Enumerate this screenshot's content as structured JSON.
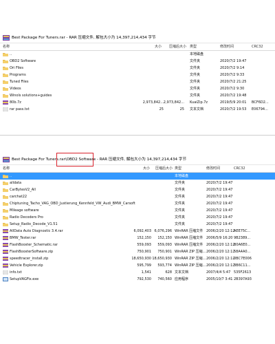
{
  "colors": {
    "selection": "#3399ff",
    "highlight_box": "#d9212b",
    "folder": "#e8b84a"
  },
  "top": {
    "title": "Best Package For Tuners.rar - RAR 压缩文件, 解包大小为 14,397,214,434 字节",
    "headers": {
      "name": "名称",
      "size": "大小",
      "packed": "压缩后大小",
      "type": "类型",
      "modified": "修改时间",
      "crc": "CRC32"
    },
    "rows": [
      {
        "icon": "folder-icon",
        "name": "..",
        "size": "",
        "packed": "",
        "type": "本地磁盘",
        "modified": "",
        "crc": ""
      },
      {
        "icon": "folder-icon",
        "name": "OBD2 Software",
        "size": "",
        "packed": "",
        "type": "文件夹",
        "modified": "2020/7/2 19:47",
        "crc": ""
      },
      {
        "icon": "folder-icon",
        "name": "Ori Files",
        "size": "",
        "packed": "",
        "type": "文件夹",
        "modified": "2020/7/2 9:14",
        "crc": ""
      },
      {
        "icon": "folder-icon",
        "name": "Programs",
        "size": "",
        "packed": "",
        "type": "文件夹",
        "modified": "2020/7/2 9:33",
        "crc": ""
      },
      {
        "icon": "folder-icon",
        "name": "Tuned Files",
        "size": "",
        "packed": "",
        "type": "文件夹",
        "modified": "2020/7/2 21:25",
        "crc": ""
      },
      {
        "icon": "folder-icon",
        "name": "Videos",
        "size": "",
        "packed": "",
        "type": "文件夹",
        "modified": "2020/7/2 9:30",
        "crc": ""
      },
      {
        "icon": "folder-icon",
        "name": "Winols solutions+guides",
        "size": "",
        "packed": "",
        "type": "文件夹",
        "modified": "2020/7/2 19:48",
        "crc": ""
      },
      {
        "icon": "archive-icon",
        "name": "80b.7z",
        "size": "2,973,842...",
        "packed": "2,973,842...",
        "type": "KuaiZip.7z",
        "modified": "2019/5/9 20:01",
        "crc": "BCF6D2..."
      },
      {
        "icon": "text-file-icon",
        "name": "rar pass.txt",
        "size": "25",
        "packed": "25",
        "type": "文本文档",
        "modified": "2020/7/2 19:53",
        "crc": "E06794..."
      }
    ]
  },
  "bottom": {
    "title_prefix": "Best Package For Tuners.rar\\",
    "title_highlight": "OBD2 Software",
    "title_suffix": " - RAR 压缩文件, 解包大小为 14,397,214,434 字节",
    "headers": {
      "name": "名称",
      "size": "大小",
      "packed": "压缩后大小",
      "type": "类型",
      "modified": "修改时间",
      "crc": "CRC32"
    },
    "rows": [
      {
        "icon": "folder-icon",
        "name": "..",
        "size": "",
        "packed": "",
        "type": "本地磁盘",
        "modified": "",
        "crc": "",
        "selected": true
      },
      {
        "icon": "folder-icon",
        "name": "alldata",
        "size": "",
        "packed": "",
        "type": "文件夹",
        "modified": "2020/7/2 19:47",
        "crc": ""
      },
      {
        "icon": "folder-icon",
        "name": "CarBytesV2_All",
        "size": "",
        "packed": "",
        "type": "文件夹",
        "modified": "2020/7/2 19:47",
        "crc": ""
      },
      {
        "icon": "folder-icon",
        "name": "carchat22",
        "size": "",
        "packed": "",
        "type": "文件夹",
        "modified": "2020/7/2 19:47",
        "crc": ""
      },
      {
        "icon": "folder-icon",
        "name": "Chiptuning_Tacho_VAG_OBD_Justierung_Kennfeld_VW_Audi_BMW_Carsoft",
        "size": "",
        "packed": "",
        "type": "文件夹",
        "modified": "2020/7/2 19:47",
        "crc": ""
      },
      {
        "icon": "folder-icon",
        "name": "Mileage software",
        "size": "",
        "packed": "",
        "type": "文件夹",
        "modified": "2020/7/2 19:47",
        "crc": ""
      },
      {
        "icon": "folder-icon",
        "name": "Radio Decoders Pro",
        "size": "",
        "packed": "",
        "type": "文件夹",
        "modified": "2020/7/2 19:47",
        "crc": ""
      },
      {
        "icon": "folder-icon",
        "name": "Setup_Radio_Decode_V1.51",
        "size": "",
        "packed": "",
        "type": "文件夹",
        "modified": "2020/7/2 19:47",
        "crc": ""
      },
      {
        "icon": "archive-icon",
        "name": "AllData Auto Diagnostic 3.4.rar",
        "size": "6,092,403",
        "packed": "6,076,296",
        "type": "WinRAR 压缩文件",
        "modified": "2006/2/20 12:12",
        "crc": "AEE75C..."
      },
      {
        "icon": "archive-icon",
        "name": "BMW_Tester.rar",
        "size": "152,150",
        "packed": "152,150",
        "type": "WinRAR 压缩文件",
        "modified": "2006/5/9 16:20",
        "crc": "9B2389..."
      },
      {
        "icon": "archive-icon",
        "name": "FlashBooster_Schematic.rar",
        "size": "559,093",
        "packed": "559,093",
        "type": "WinRAR 压缩文件",
        "modified": "2006/2/20 12:12",
        "crc": "B0A6E0..."
      },
      {
        "icon": "archive-icon",
        "name": "FlashBoosterSoftware.zip",
        "size": "750,901",
        "packed": "750,901",
        "type": "WinRAR ZIP 压缩...",
        "modified": "2006/2/20 12:12",
        "crc": "58A4A0..."
      },
      {
        "icon": "archive-icon",
        "name": "speedtracer_install.zip",
        "size": "18,650,930",
        "packed": "18,650,930",
        "type": "WinRAR ZIP 压缩...",
        "modified": "2006/2/20 12:12",
        "crc": "0BC7E006"
      },
      {
        "icon": "archive-icon",
        "name": "Vehicle Explorer.zip",
        "size": "595,799",
        "packed": "593,774",
        "type": "WinRAR ZIP 压缩...",
        "modified": "2006/2/20 12:12",
        "crc": "3B6C11..."
      },
      {
        "icon": "text-file-icon",
        "name": "info.txt",
        "size": "1,541",
        "packed": "628",
        "type": "文本文档",
        "modified": "2007/4/4 5:47",
        "crc": "535F2613"
      },
      {
        "icon": "exe-icon",
        "name": "SetupVAGFix.exe",
        "size": "792,530",
        "packed": "740,560",
        "type": "应用程序",
        "modified": "2005/10/7 3:41",
        "crc": "2B397A93"
      }
    ]
  }
}
